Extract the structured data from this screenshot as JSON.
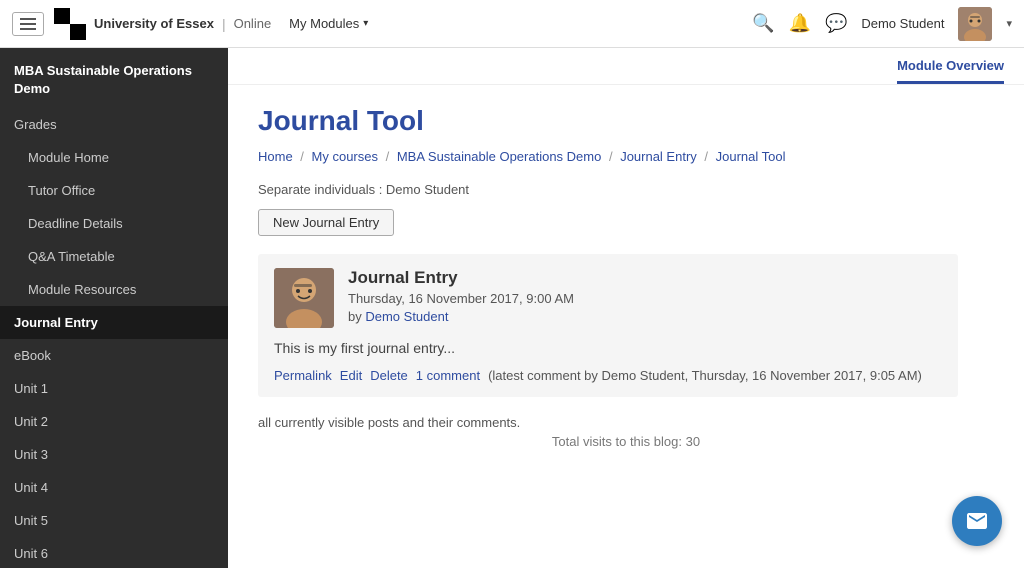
{
  "topnav": {
    "logo_text": "University of Essex",
    "logo_divider": "|",
    "logo_online": "Online",
    "modules_label": "My Modules",
    "username": "Demo Student",
    "search_icon": "🔍",
    "bell_icon": "🔔",
    "chat_icon": "💬"
  },
  "sidebar": {
    "course_title": "MBA Sustainable Operations Demo",
    "items": [
      {
        "label": "Grades",
        "indented": false,
        "active": false
      },
      {
        "label": "Module Home",
        "indented": true,
        "active": false
      },
      {
        "label": "Tutor Office",
        "indented": true,
        "active": false
      },
      {
        "label": "Deadline Details",
        "indented": true,
        "active": false
      },
      {
        "label": "Q&A Timetable",
        "indented": true,
        "active": false
      },
      {
        "label": "Module Resources",
        "indented": true,
        "active": false
      },
      {
        "label": "Journal Entry",
        "indented": false,
        "active": true
      },
      {
        "label": "eBook",
        "indented": false,
        "active": false
      },
      {
        "label": "Unit 1",
        "indented": false,
        "active": false
      },
      {
        "label": "Unit 2",
        "indented": false,
        "active": false
      },
      {
        "label": "Unit 3",
        "indented": false,
        "active": false
      },
      {
        "label": "Unit 4",
        "indented": false,
        "active": false
      },
      {
        "label": "Unit 5",
        "indented": false,
        "active": false
      },
      {
        "label": "Unit 6",
        "indented": false,
        "active": false
      }
    ]
  },
  "module_overview_tab": "Module Overview",
  "page": {
    "title": "Journal Tool",
    "breadcrumb": [
      {
        "label": "Home",
        "href": "#"
      },
      {
        "label": "My courses",
        "href": "#"
      },
      {
        "label": "MBA Sustainable Operations Demo",
        "href": "#"
      },
      {
        "label": "Journal Entry",
        "href": "#"
      },
      {
        "label": "Journal Tool",
        "href": "#"
      }
    ],
    "separate_label": "Separate individuals : Demo Student",
    "new_journal_btn": "New Journal Entry",
    "journal_entry": {
      "title": "Journal Entry",
      "date": "Thursday, 16 November 2017, 9:00 AM",
      "by_prefix": "by",
      "author": "Demo Student",
      "body": "This is my first journal entry...",
      "permalink": "Permalink",
      "edit": "Edit",
      "delete": "Delete",
      "comment_link": "1 comment",
      "comment_info": "(latest comment by Demo Student, Thursday, 16 November 2017, 9:05 AM)"
    },
    "posts_note": "all currently visible posts and their comments.",
    "total_visits": "Total visits to this blog: 30"
  }
}
